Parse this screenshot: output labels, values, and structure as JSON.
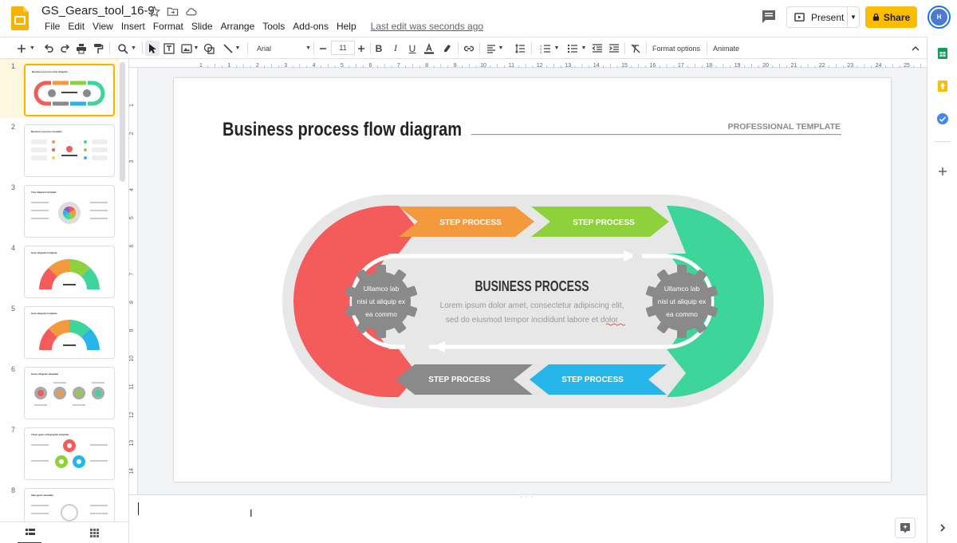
{
  "app": {
    "doc_title": "GS_Gears_tool_16-9",
    "menu": [
      "File",
      "Edit",
      "View",
      "Insert",
      "Format",
      "Slide",
      "Arrange",
      "Tools",
      "Add-ons",
      "Help"
    ],
    "last_edit": "Last edit was seconds ago",
    "present_label": "Present",
    "share_label": "Share",
    "avatar_initials": "H"
  },
  "toolbar": {
    "font_name": "Arial",
    "font_size": "11",
    "format_options": "Format options",
    "animate": "Animate"
  },
  "ruler": {
    "top_ticks": [
      "1",
      "1",
      "2",
      "3",
      "4",
      "5",
      "6",
      "7",
      "8",
      "9",
      "10",
      "11",
      "12",
      "13",
      "14",
      "15",
      "16",
      "17",
      "18",
      "19",
      "20",
      "21",
      "22",
      "23",
      "24",
      "25"
    ],
    "left_ticks": [
      "1",
      "2",
      "3",
      "4",
      "5",
      "6",
      "7",
      "8",
      "9",
      "10",
      "11",
      "12",
      "13",
      "14"
    ]
  },
  "filmstrip": {
    "slides": [
      {
        "num": "1",
        "title": "Business process flow diagram"
      },
      {
        "num": "2",
        "title": "Business process template"
      },
      {
        "num": "3",
        "title": "Tree diagram template"
      },
      {
        "num": "4",
        "title": "Gear diagram template"
      },
      {
        "num": "5",
        "title": "Gear diagram template"
      },
      {
        "num": "6",
        "title": "Gears diagram template"
      },
      {
        "num": "7",
        "title": "Three gears infographic template"
      },
      {
        "num": "8",
        "title": "Idea gears template"
      }
    ]
  },
  "slide": {
    "title": "Business process flow diagram",
    "subtitle": "PROFESSIONAL TEMPLATE",
    "steps": [
      "STEP PROCESS",
      "STEP PROCESS",
      "STEP PROCESS",
      "STEP PROCESS"
    ],
    "center_title": "BUSINESS PROCESS",
    "center_body_1": "Lorem ipsum dolor amet, consectetur adipiscing elit,",
    "center_body_2": "sed do eiusmod tempor incididunt  labore et dolor",
    "gear_left": [
      "Ullamco lab",
      "nisi ut aliquip ex",
      "ea commo"
    ],
    "gear_right": [
      "Ullamco lab",
      "nisi ut aliquip ex",
      "ea commo"
    ],
    "colors": {
      "red": "#f45b5b",
      "orange": "#f39a3f",
      "green": "#8fd13d",
      "teal": "#3dd59a",
      "gray": "#8a8a8a",
      "blue": "#27b6ec",
      "track": "#e7e7e7"
    }
  },
  "notes": {
    "ibeam": "I"
  }
}
